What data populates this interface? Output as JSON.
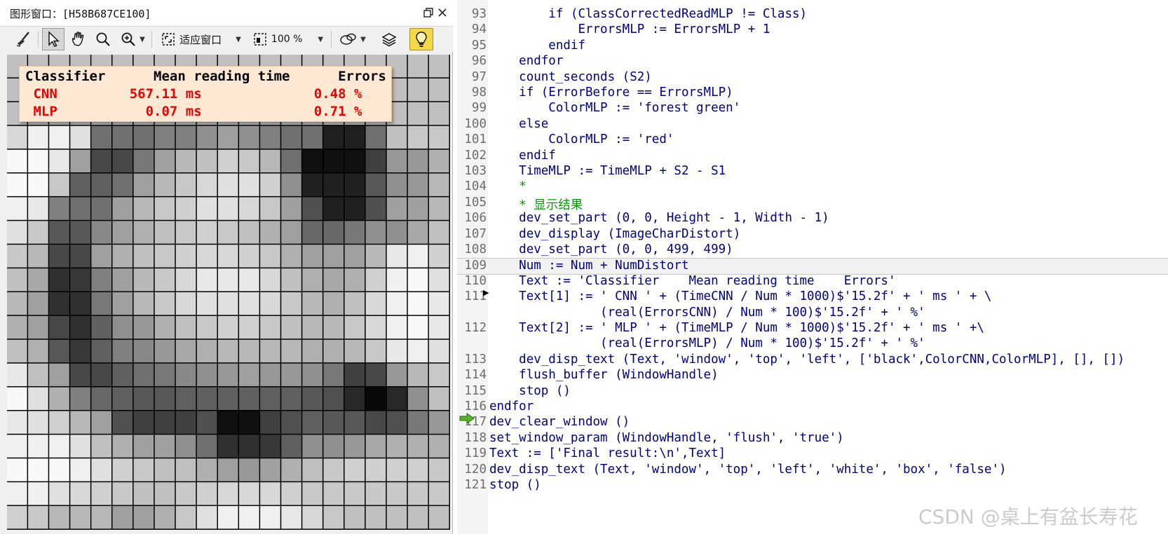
{
  "graphics_window": {
    "title": "图形窗口：[H58B687CE100]",
    "toolbar": {
      "zoom_mode_label": "适应窗口",
      "zoom_percent_label": "100 %"
    },
    "image": {
      "grid_columns": 21,
      "grid_rows": 20,
      "gray_levels": [
        "C0C0C0C0C0C0C0C0C0C0C0C0C0C0C0C0C0C0C0C0C0",
        "C0C0C0C0C0C0C0C0C0C0C0C0C0C0C0C0C0C0C0C0C0",
        "C0C0C0C0C0C0C0C0C0C0C0C0C0C0C0C0C0C0C0C0C0",
        "D8F0F0E0707070808090A090807070202070C0C8C8",
        "F8F8E8A0484878A0B8C0D0C8B870101010409898B0",
        "F8F8C8606070A0B8C8D8E0E0D090202020589098B8",
        "F0E8807070A0B8C8D0E0E0D8C8A050202050A0A0B8",
        "E0C8585888A0B0C0C8D0C8C0B0A06868789090A8C0",
        "C8B84848A0B0C0C8D0D8D8D0C8B0A0A0A0B8E8F0D0",
        "C0A8303880A0B8C8D8E8E8E8D8C0B0A8B0D0F0F8E0",
        "B8A0303078A0B8C8D8E0E0E0D8C8B8B0C0D8F0F8E8",
        "B0A04830609098B0C0C8D0D0C8C0B8B8C8D8F0F8E8",
        "C0B0583860808898A8B0B8B8B8B8B0B0B8C8E8F0E0",
        "E8C0A04848607078889098A098989078404898B8C8",
        "F8E0B08068605858606060606060585028082890C0",
        "E8E0D0B8A050404040501010405060585848507898",
        "F0F0F0E0C0B0A0A0907030303860909098A8B0B0B0",
        "F8F8F8F0E0D0C8C0C0B0A098A0B0C0C8D0D0D0D0C8",
        "F0F0E0D8D0C8C0C0C8D0D8D8D8D0C8C8C8C8C8C8C8",
        "D0C8B8B8B8A0A0B0C8E0F0F0F0E8D8C8C0C0C0C0C0"
      ]
    },
    "results": {
      "header": "Classifier      Mean reading time      Errors",
      "rows": [
        {
          "text": " CNN         567.11 ms              0.48 %",
          "color": "#ee0000"
        },
        {
          "text": " MLP           0.07 ms              0.71 %",
          "color": "#ee0000"
        }
      ],
      "header_color": "#000000"
    }
  },
  "editor": {
    "lines": [
      {
        "n": "93",
        "indent": "        ",
        "parts": [
          {
            "t": "if (ClassCorrectedReadMLP != Class)",
            "c": "kw"
          }
        ]
      },
      {
        "n": "94",
        "indent": "            ",
        "parts": [
          {
            "t": "ErrorsMLP := ErrorsMLP + 1",
            "c": "kw"
          }
        ]
      },
      {
        "n": "95",
        "indent": "        ",
        "parts": [
          {
            "t": "endif",
            "c": "kw"
          }
        ]
      },
      {
        "n": "96",
        "indent": "    ",
        "parts": [
          {
            "t": "endfor",
            "c": "kw"
          }
        ]
      },
      {
        "n": "97",
        "indent": "    ",
        "parts": [
          {
            "t": "count_seconds",
            "c": "kw"
          },
          {
            "t": " (S2)",
            "c": "kw"
          }
        ]
      },
      {
        "n": "98",
        "indent": "    ",
        "parts": [
          {
            "t": "if (ErrorBefore == ErrorsMLP)",
            "c": "kw"
          }
        ]
      },
      {
        "n": "99",
        "indent": "        ",
        "parts": [
          {
            "t": "ColorMLP := 'forest green'",
            "c": "kw"
          }
        ]
      },
      {
        "n": "100",
        "indent": "    ",
        "parts": [
          {
            "t": "else",
            "c": "kw"
          }
        ]
      },
      {
        "n": "101",
        "indent": "        ",
        "parts": [
          {
            "t": "ColorMLP := 'red'",
            "c": "kw"
          }
        ]
      },
      {
        "n": "102",
        "indent": "    ",
        "parts": [
          {
            "t": "endif",
            "c": "kw"
          }
        ]
      },
      {
        "n": "103",
        "indent": "    ",
        "parts": [
          {
            "t": "TimeMLP := TimeMLP + S2 - S1",
            "c": "kw"
          }
        ]
      },
      {
        "n": "104",
        "indent": "    ",
        "parts": [
          {
            "t": "*",
            "c": "cm"
          }
        ]
      },
      {
        "n": "105",
        "indent": "    ",
        "parts": [
          {
            "t": "* 显示结果",
            "c": "cm"
          }
        ]
      },
      {
        "n": "106",
        "indent": "    ",
        "parts": [
          {
            "t": "dev_set_part (0, 0, Height - 1, Width - 1)",
            "c": "kw"
          }
        ]
      },
      {
        "n": "107",
        "indent": "    ",
        "parts": [
          {
            "t": "dev_display (ImageCharDistort)",
            "c": "kw"
          }
        ]
      },
      {
        "n": "108",
        "indent": "    ",
        "parts": [
          {
            "t": "dev_set_part (0, 0, 499, 499)",
            "c": "kw"
          }
        ]
      },
      {
        "n": "109",
        "indent": "    ",
        "parts": [
          {
            "t": "Num := Num + NumDistort",
            "c": "kw"
          }
        ],
        "current": true
      },
      {
        "n": "110",
        "indent": "    ",
        "parts": [
          {
            "t": "Text := 'Classifier    Mean reading time    Errors'",
            "c": "kw"
          }
        ]
      },
      {
        "n": "111",
        "indent": "    ",
        "parts": [
          {
            "t": "Text[1] := ' CNN ' + (TimeCNN / Num * 1000)$'15.2f' + ' ms ' + \\",
            "c": "kw"
          }
        ]
      },
      {
        "n": "",
        "indent": "               ",
        "parts": [
          {
            "t": "(real(ErrorsCNN) / Num * 100)$'15.2f' + ' %'",
            "c": "kw"
          }
        ]
      },
      {
        "n": "112",
        "indent": "    ",
        "parts": [
          {
            "t": "Text[2] := ' MLP ' + (TimeMLP / Num * 1000)$'15.2f' + ' ms ' +\\",
            "c": "kw"
          }
        ]
      },
      {
        "n": "",
        "indent": "               ",
        "parts": [
          {
            "t": "(real(ErrorsMLP) / Num * 100)$'15.2f' + ' %'",
            "c": "kw"
          }
        ]
      },
      {
        "n": "113",
        "indent": "    ",
        "parts": [
          {
            "t": "dev_disp_text (Text, 'window', 'top', 'left', ['black',ColorCNN,ColorMLP], [], [])",
            "c": "kw"
          }
        ]
      },
      {
        "n": "114",
        "indent": "    ",
        "parts": [
          {
            "t": "flush_buffer (WindowHandle)",
            "c": "kw"
          }
        ]
      },
      {
        "n": "115",
        "indent": "    ",
        "parts": [
          {
            "t": "stop ()",
            "c": "kw"
          }
        ],
        "pc": true
      },
      {
        "n": "116",
        "indent": "",
        "parts": [
          {
            "t": "endfor",
            "c": "kw"
          }
        ]
      },
      {
        "n": "117",
        "indent": "",
        "parts": [
          {
            "t": "dev_clear_window ()",
            "c": "kw"
          }
        ]
      },
      {
        "n": "118",
        "indent": "",
        "parts": [
          {
            "t": "set_window_param (WindowHandle, 'flush', 'true')",
            "c": "kw"
          }
        ]
      },
      {
        "n": "119",
        "indent": "",
        "parts": [
          {
            "t": "Text := ['Final result:\\n',Text]",
            "c": "kw"
          }
        ]
      },
      {
        "n": "120",
        "indent": "",
        "parts": [
          {
            "t": "dev_disp_text (Text, 'window', 'top', 'left', 'white', 'box', 'false')",
            "c": "kw"
          }
        ]
      },
      {
        "n": "121",
        "indent": "",
        "parts": [
          {
            "t": "stop ()",
            "c": "kw"
          }
        ]
      }
    ]
  },
  "watermark": "CSDN @桌上有盆长寿花",
  "colors": {
    "keyword": "#000080",
    "comment": "#009900",
    "result_red": "#ee0000",
    "note_box": "#fde8d4",
    "light_button": "#f5d848"
  }
}
